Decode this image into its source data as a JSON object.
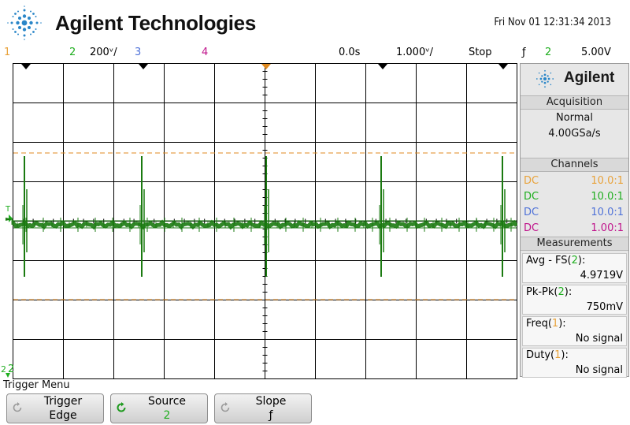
{
  "header": {
    "brand": "Agilent Technologies",
    "datetime": "Fri Nov 01 12:31:34 2013"
  },
  "statusbar": {
    "ch1_label": "1",
    "ch2_label": "2",
    "ch2_scale": "200ᵛ/",
    "ch3_label": "3",
    "ch4_label": "4",
    "time_delay": "0.0s",
    "time_scale": "1.000ᵛ/",
    "run_state": "Stop",
    "trigger_slope_symbol": "ƒ",
    "trigger_source": "2",
    "trigger_level": "5.00V"
  },
  "colors": {
    "ch1": "#e8a23a",
    "ch2": "#1fae1f",
    "ch2_trace": "#1a7a10",
    "ch3": "#4f72d8",
    "ch4": "#c0148c",
    "grid": "#000000",
    "cursor": "#e08a20"
  },
  "screen": {
    "ground_marker": "2",
    "trigger_marker": "T"
  },
  "panel": {
    "logo_text": "Agilent",
    "acquisition": {
      "title": "Acquisition",
      "mode": "Normal",
      "sample_rate": "4.00GSa/s"
    },
    "channels": {
      "title": "Channels",
      "rows": [
        {
          "coupling": "DC",
          "probe": "10.0:1",
          "color": "#e8a23a"
        },
        {
          "coupling": "DC",
          "probe": "10.0:1",
          "color": "#1fae1f"
        },
        {
          "coupling": "DC",
          "probe": "10.0:1",
          "color": "#4f72d8"
        },
        {
          "coupling": "DC",
          "probe": "1.00:1",
          "color": "#c0148c"
        }
      ]
    },
    "measurements": {
      "title": "Measurements",
      "items": [
        {
          "name": "Avg - FS",
          "channel": "2",
          "value": "4.9719V"
        },
        {
          "name": "Pk-Pk",
          "channel": "2",
          "value": "750mV"
        },
        {
          "name": "Freq",
          "channel": "1",
          "value": "No signal"
        },
        {
          "name": "Duty",
          "channel": "1",
          "value": "No signal"
        }
      ]
    }
  },
  "menu": {
    "title": "Trigger Menu",
    "softkeys": [
      {
        "label": "Trigger",
        "value": "Edge"
      },
      {
        "label": "Source",
        "value": "2"
      },
      {
        "label": "Slope",
        "value": "ƒ"
      }
    ]
  }
}
